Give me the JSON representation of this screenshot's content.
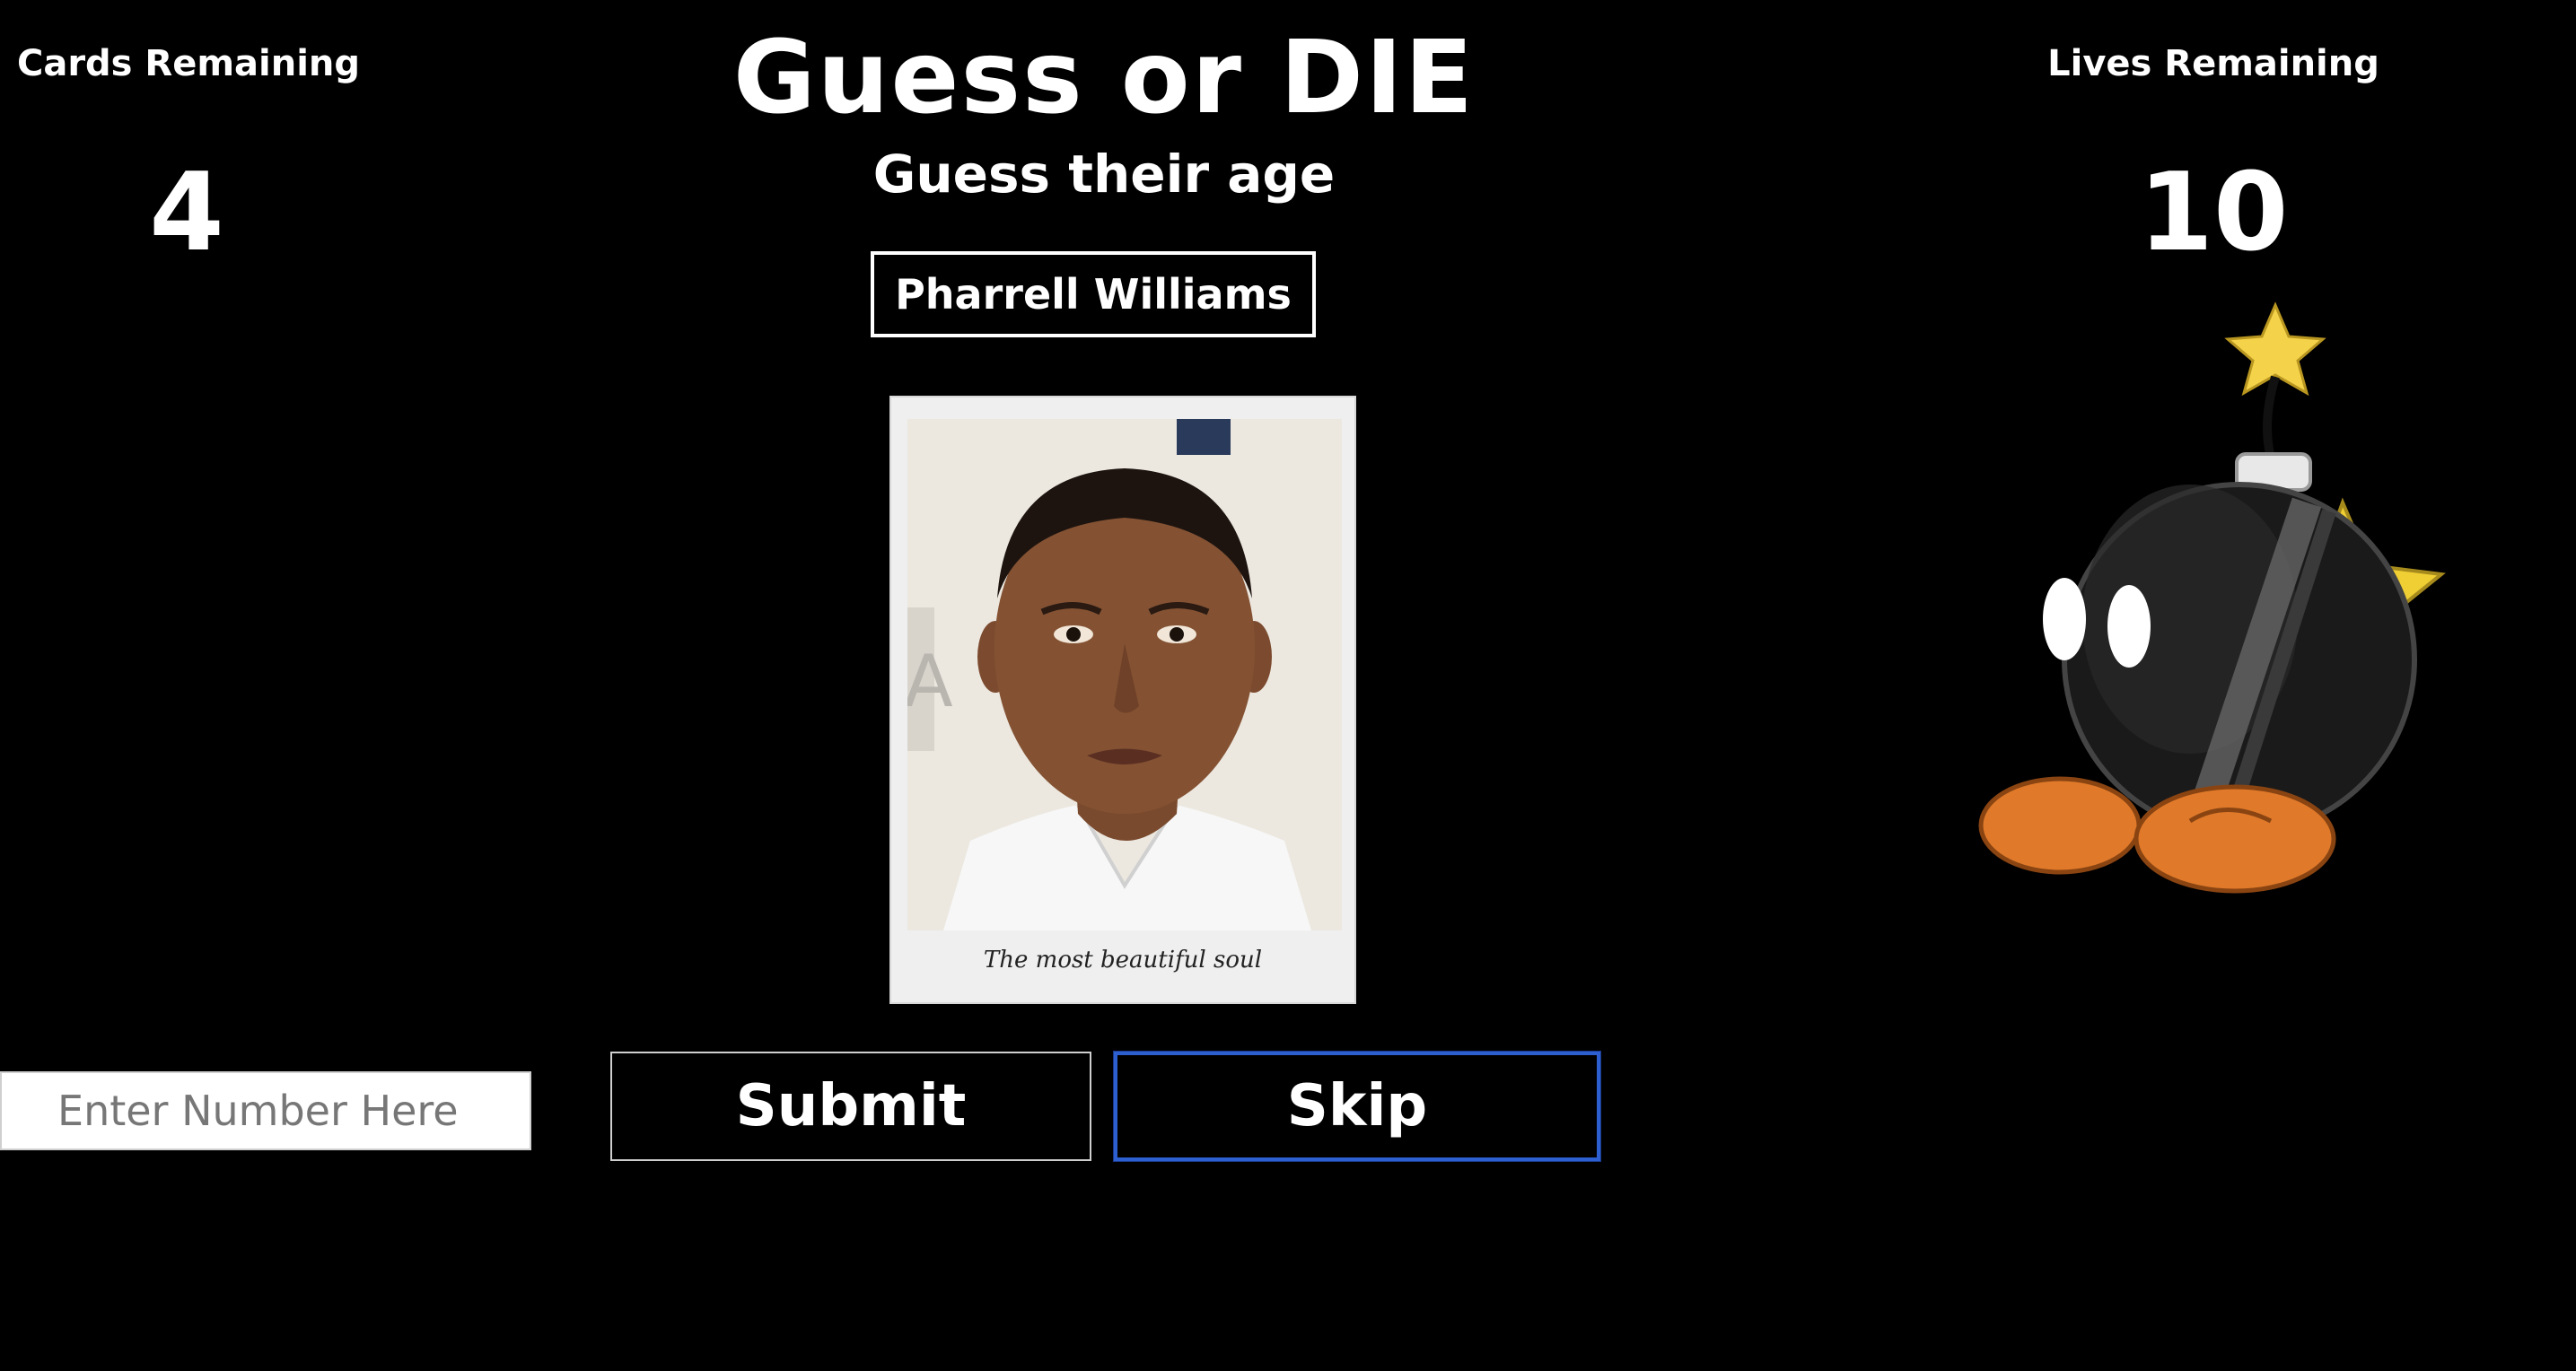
{
  "header": {
    "title": "Guess or DIE",
    "subtitle": "Guess their age"
  },
  "stats": {
    "cards_label": "Cards Remaining",
    "cards_value": "4",
    "lives_label": "Lives Remaining",
    "lives_value": "10"
  },
  "card": {
    "person_name": "Pharrell Williams",
    "photo_caption": "The most beautiful soul",
    "photo_icon": "portrait-photo"
  },
  "mascot": {
    "icon": "bob-omb-icon",
    "colors": {
      "body": "#1c1c1c",
      "feet": "#e07a2a",
      "star": "#f2d24a"
    }
  },
  "controls": {
    "input_placeholder": "Enter Number Here",
    "input_value": "",
    "submit_label": "Submit",
    "skip_label": "Skip",
    "focus_color": "#2d5fd0"
  }
}
